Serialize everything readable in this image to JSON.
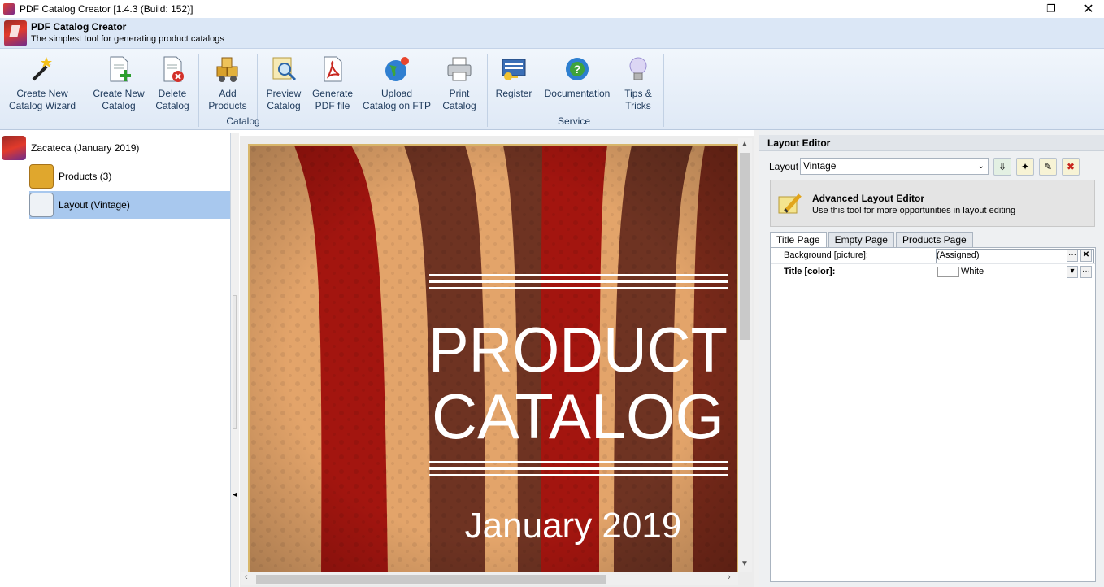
{
  "window": {
    "title": "PDF Catalog Creator [1.4.3 (Build: 152)]"
  },
  "header": {
    "app_name": "PDF Catalog Creator",
    "tagline": "The simplest tool for generating product catalogs"
  },
  "ribbon": {
    "buttons": [
      {
        "line1": "Create New",
        "line2": "Catalog Wizard"
      },
      {
        "line1": "Create New",
        "line2": "Catalog"
      },
      {
        "line1": "Delete",
        "line2": "Catalog"
      },
      {
        "line1": "Add",
        "line2": "Products"
      },
      {
        "line1": "Preview",
        "line2": "Catalog"
      },
      {
        "line1": "Generate",
        "line2": "PDF file"
      },
      {
        "line1": "Upload",
        "line2": "Catalog on FTP"
      },
      {
        "line1": "Print",
        "line2": "Catalog"
      },
      {
        "line1": "Register",
        "line2": ""
      },
      {
        "line1": "Documentation",
        "line2": ""
      },
      {
        "line1": "Tips &",
        "line2": "Tricks"
      }
    ],
    "groups": {
      "catalog": "Catalog",
      "service": "Service"
    }
  },
  "tree": {
    "items": [
      {
        "label": "Zacateca (January 2019)"
      },
      {
        "label": "Products (3)"
      },
      {
        "label": "Layout (Vintage)"
      }
    ]
  },
  "preview": {
    "title_line1": "PRODUCT",
    "title_line2": "CATALOG",
    "date": "January 2019"
  },
  "layout_editor": {
    "heading": "Layout Editor",
    "layout_label": "Layout",
    "layout_value": "Vintage",
    "advanced_title": "Advanced Layout Editor",
    "advanced_desc": "Use this tool for more opportunities in layout editing",
    "tabs": [
      "Title Page",
      "Empty Page",
      "Products Page"
    ],
    "properties": [
      {
        "name": "Background [picture]:",
        "value": "(Assigned)"
      },
      {
        "name": "Title [color]:",
        "value": "White"
      }
    ]
  },
  "colors": {
    "accent": "#a8c8ee",
    "ribbon": "#dfe9f6",
    "stripe_red": "#a3150f",
    "stripe_brown": "#6e3322",
    "stripe_tan": "#e3a46a"
  }
}
